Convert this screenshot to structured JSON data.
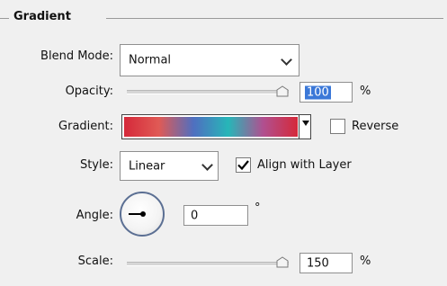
{
  "section": {
    "title": "Gradient"
  },
  "blend_mode": {
    "label": "Blend Mode:",
    "value": "Normal"
  },
  "opacity": {
    "label": "Opacity:",
    "value": "100",
    "unit": "%",
    "level": 1.0
  },
  "gradient": {
    "label": "Gradient:",
    "colors": [
      "#d5293a",
      "#e05a55",
      "#4f6fc0",
      "#27b6b8",
      "#b05090",
      "#d5293a"
    ]
  },
  "reverse": {
    "label": "Reverse",
    "checked": false
  },
  "style": {
    "label": "Style:",
    "value": "Linear"
  },
  "align_with_layer": {
    "label": "Align with Layer",
    "checked": true
  },
  "angle": {
    "label": "Angle:",
    "value": "0",
    "unit": "°"
  },
  "scale": {
    "label": "Scale:",
    "value": "150",
    "unit": "%",
    "level": 1.0
  }
}
